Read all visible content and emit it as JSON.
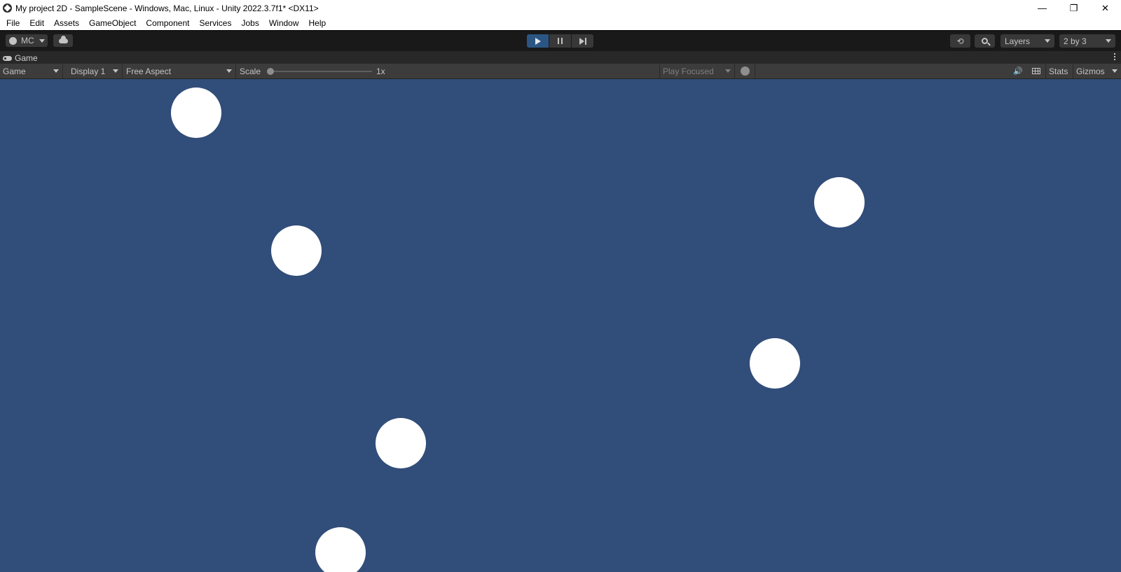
{
  "window": {
    "title": "My project 2D - SampleScene - Windows, Mac, Linux - Unity 2022.3.7f1* <DX11>",
    "minimize_glyph": "—",
    "restore_glyph": "❐",
    "close_glyph": "✕"
  },
  "menu": {
    "items": [
      "File",
      "Edit",
      "Assets",
      "GameObject",
      "Component",
      "Services",
      "Jobs",
      "Window",
      "Help"
    ]
  },
  "toolbar": {
    "account_label": "MC",
    "play_state": "playing",
    "history_glyph": "⟲",
    "layers_label": "Layers",
    "layout_label": "2 by 3"
  },
  "panel": {
    "tab_label": "Game"
  },
  "game_toolbar": {
    "view_mode": "Game",
    "display": "Display 1",
    "aspect": "Free Aspect",
    "scale_label": "Scale",
    "scale_value": "1x",
    "play_mode": "Play Focused",
    "audio_glyph": "🔊",
    "stats_label": "Stats",
    "gizmos_label": "Gizmos"
  },
  "scene": {
    "background_color": "#314d79",
    "ball_color": "#ffffff",
    "ball_count": 6
  }
}
